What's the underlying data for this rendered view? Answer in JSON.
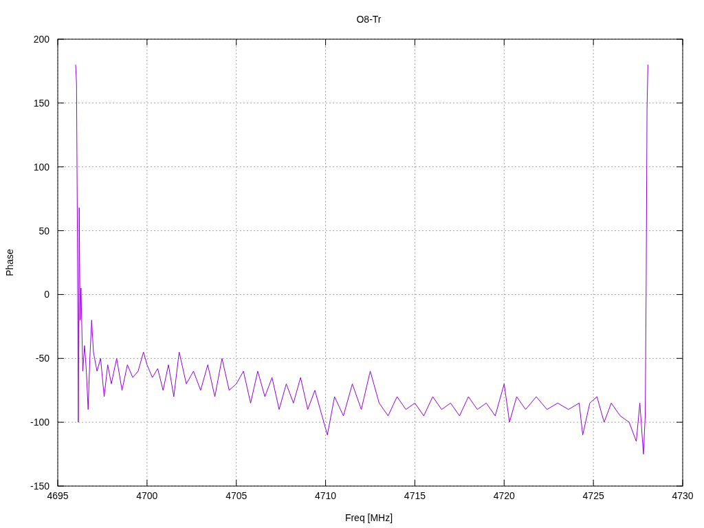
{
  "chart_data": {
    "type": "line",
    "title": "O8-Tr",
    "xlabel": "Freq [MHz]",
    "ylabel": "Phase",
    "grid": true,
    "xlim": [
      4695,
      4730
    ],
    "ylim": [
      -150,
      200
    ],
    "xticks": [
      4695,
      4700,
      4705,
      4710,
      4715,
      4720,
      4725,
      4730
    ],
    "yticks": [
      -150,
      -100,
      -50,
      0,
      50,
      100,
      150,
      200
    ],
    "x": [
      4696.0,
      4696.05,
      4696.1,
      4696.15,
      4696.2,
      4696.25,
      4696.3,
      4696.4,
      4696.5,
      4696.6,
      4696.7,
      4696.8,
      4696.9,
      4697.0,
      4697.2,
      4697.4,
      4697.6,
      4697.8,
      4698.0,
      4698.3,
      4698.6,
      4698.9,
      4699.2,
      4699.5,
      4699.8,
      4700,
      4700.3,
      4700.6,
      4700.9,
      4701.2,
      4701.5,
      4701.8,
      4702.2,
      4702.6,
      4703,
      4703.4,
      4703.8,
      4704.2,
      4704.6,
      4705,
      4705.4,
      4705.8,
      4706.2,
      4706.6,
      4707,
      4707.4,
      4707.8,
      4708.2,
      4708.6,
      4709,
      4709.4,
      4709.8,
      4710.1,
      4710.5,
      4711,
      4711.5,
      4712,
      4712.5,
      4713,
      4713.5,
      4714,
      4714.5,
      4715,
      4715.5,
      4716,
      4716.5,
      4717,
      4717.5,
      4718,
      4718.5,
      4719,
      4719.5,
      4720,
      4720.3,
      4720.7,
      4721.2,
      4721.8,
      4722.4,
      4723,
      4723.6,
      4724.2,
      4724.4,
      4724.8,
      4725.2,
      4725.6,
      4726,
      4726.5,
      4727,
      4727.4,
      4727.6,
      4727.8,
      4727.9,
      4727.95,
      4728,
      4728.05
    ],
    "series": [
      {
        "color": "#9400d3",
        "values": [
          180,
          165,
          45,
          -100,
          68,
          -20,
          5,
          -60,
          -40,
          -60,
          -90,
          -50,
          -20,
          -45,
          -60,
          -50,
          -80,
          -55,
          -70,
          -50,
          -75,
          -55,
          -65,
          -60,
          -45,
          -55,
          -65,
          -58,
          -75,
          -55,
          -80,
          -45,
          -70,
          -60,
          -75,
          -55,
          -80,
          -50,
          -75,
          -70,
          -60,
          -85,
          -60,
          -80,
          -65,
          -90,
          -70,
          -85,
          -65,
          -90,
          -75,
          -95,
          -110,
          -80,
          -95,
          -70,
          -90,
          -60,
          -85,
          -95,
          -80,
          -90,
          -85,
          -95,
          -80,
          -90,
          -85,
          -95,
          -80,
          -90,
          -85,
          -95,
          -70,
          -100,
          -80,
          -90,
          -80,
          -90,
          -85,
          -90,
          -85,
          -110,
          -85,
          -80,
          -100,
          -85,
          -95,
          -100,
          -115,
          -85,
          -125,
          -95,
          0,
          145,
          180
        ]
      }
    ]
  }
}
